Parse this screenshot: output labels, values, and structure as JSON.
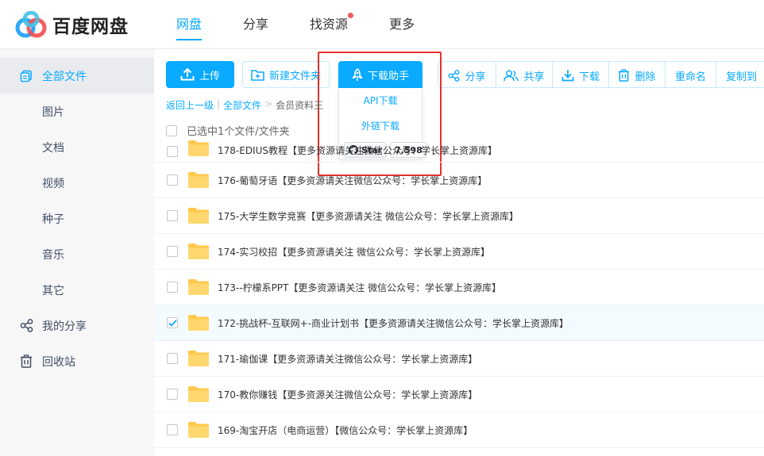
{
  "header": {
    "logo_text": "百度网盘",
    "nav": [
      {
        "label": "网盘",
        "active": true
      },
      {
        "label": "分享",
        "active": false
      },
      {
        "label": "找资源",
        "active": false,
        "dot": true
      },
      {
        "label": "更多",
        "active": false
      }
    ]
  },
  "sidebar": {
    "items": [
      {
        "label": "全部文件",
        "icon": "all-files-icon",
        "active": true
      },
      {
        "label": "图片"
      },
      {
        "label": "文档"
      },
      {
        "label": "视频"
      },
      {
        "label": "种子"
      },
      {
        "label": "音乐"
      },
      {
        "label": "其它"
      },
      {
        "label": "我的分享",
        "icon": "share-icon"
      },
      {
        "label": "回收站",
        "icon": "trash-icon"
      }
    ]
  },
  "toolbar": {
    "upload": "上传",
    "new_folder": "新建文件夹",
    "helper": "下载助手",
    "group": [
      "分享",
      "共享",
      "下载",
      "删除",
      "重命名",
      "复制到"
    ]
  },
  "helper_menu": {
    "items": [
      "API下载",
      "外链下载"
    ],
    "star_label": "Star",
    "star_count": "7,598"
  },
  "breadcrumb": {
    "back": "返回上一级",
    "all": "全部文件",
    "current": "会员资料王"
  },
  "selection": {
    "text": "已选中1个文件/文件夹"
  },
  "files": [
    {
      "name": "178-EDIUS教程【更多资源请关注微信公众号：学长掌上资源库】",
      "checked": false,
      "partial": true
    },
    {
      "name": "176-葡萄牙语【更多资源请关注微信公众号：学长掌上资源库】",
      "checked": false
    },
    {
      "name": "175-大学生数学竞赛【更多资源请关注 微信公众号：学长掌上资源库】",
      "checked": false
    },
    {
      "name": "174-实习校招【更多资源请关注 微信公众号：学长掌上资源库】",
      "checked": false
    },
    {
      "name": "173--柠檬系PPT【更多资源请关注 微信公众号：学长掌上资源库】",
      "checked": false
    },
    {
      "name": "172-挑战杯-互联网+-商业计划书【更多资源请关注微信公众号：学长掌上资源库】",
      "checked": true
    },
    {
      "name": "171-瑜伽课【更多资源请关注微信公众号：学长掌上资源库】",
      "checked": false
    },
    {
      "name": "170-教你赚钱【更多资源关注微信公众号：学长掌上资源库】",
      "checked": false
    },
    {
      "name": "169-淘宝开店（电商运营）【微信公众号：学长掌上资源库】",
      "checked": false
    }
  ],
  "colors": {
    "accent": "#09aaff",
    "highlight": "#e5322d",
    "folder": "#ffc94d"
  }
}
